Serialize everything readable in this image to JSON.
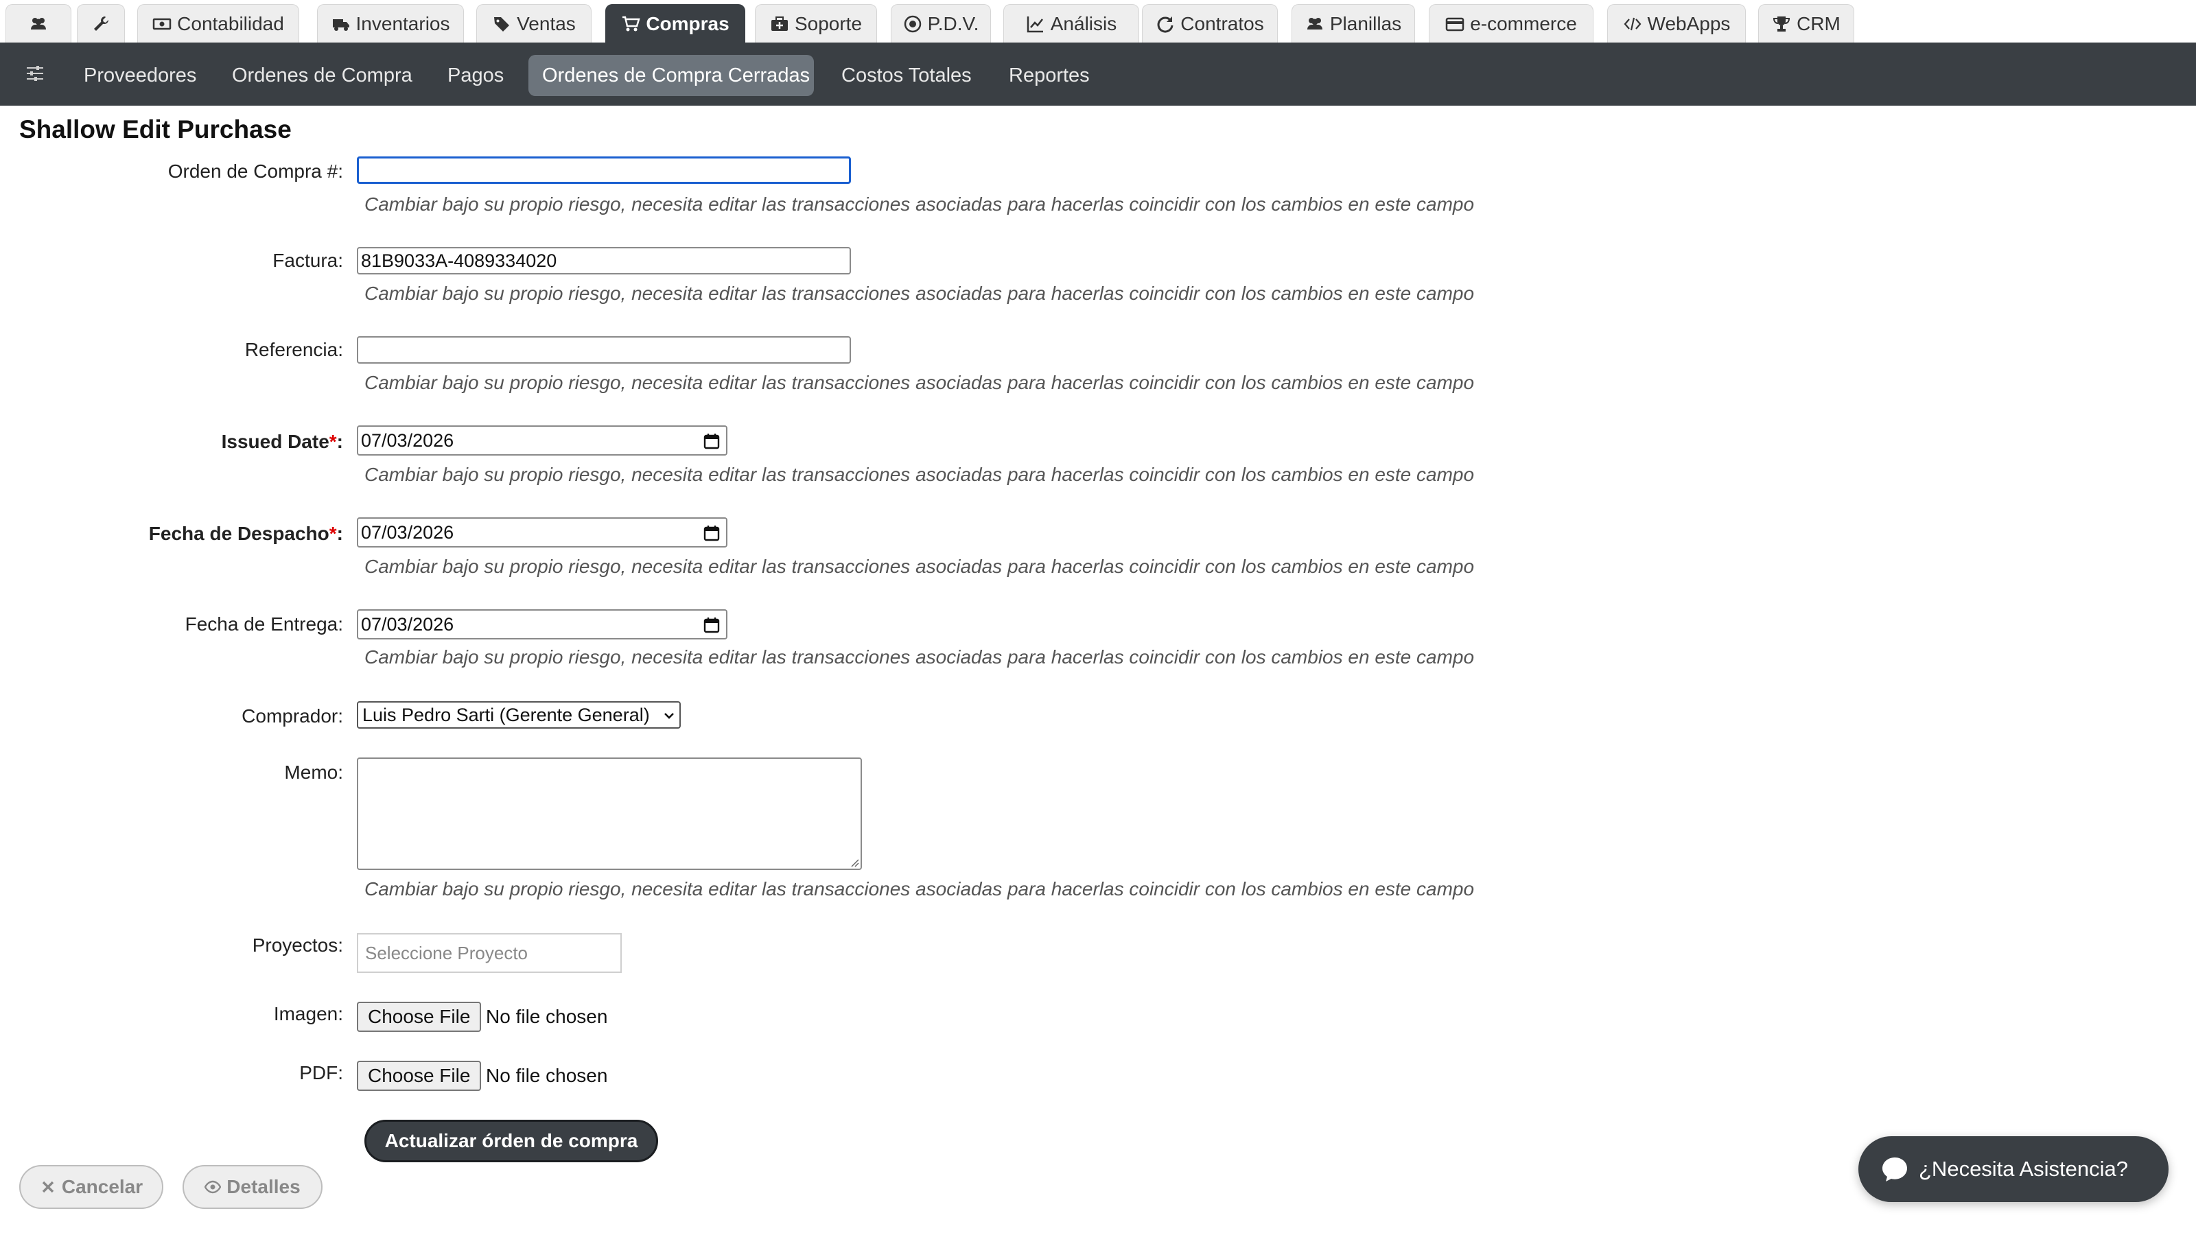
{
  "top_tabs": [
    {
      "label": "",
      "icon": "users-icon"
    },
    {
      "label": "",
      "icon": "wrench-icon"
    },
    {
      "label": "Contabilidad",
      "icon": "money-icon"
    },
    {
      "label": "Inventarios",
      "icon": "truck-icon"
    },
    {
      "label": "Ventas",
      "icon": "tags-icon"
    },
    {
      "label": "Compras",
      "icon": "cart-icon",
      "active": true
    },
    {
      "label": "Soporte",
      "icon": "medkit-icon"
    },
    {
      "label": "P.D.V.",
      "icon": "target-icon"
    },
    {
      "label": "Análisis",
      "icon": "chart-line-icon"
    },
    {
      "label": "Contratos",
      "icon": "refresh-icon"
    },
    {
      "label": "Planillas",
      "icon": "users-icon"
    },
    {
      "label": "e-commerce",
      "icon": "credit-card-icon"
    },
    {
      "label": "WebApps",
      "icon": "code-icon"
    },
    {
      "label": "CRM",
      "icon": "trophy-icon"
    }
  ],
  "sub_nav": {
    "items": [
      {
        "label": "Proveedores"
      },
      {
        "label": "Ordenes de Compra"
      },
      {
        "label": "Pagos"
      },
      {
        "label": "Ordenes de Compra Cerradas",
        "active": true
      },
      {
        "label": "Costos Totales"
      },
      {
        "label": "Reportes"
      }
    ]
  },
  "page_title": "Shallow Edit Purchase",
  "warning_text": "Cambiar bajo su propio riesgo, necesita editar las transacciones asociadas para hacerlas coincidir con los cambios en este campo",
  "fields": {
    "orden": {
      "label": "Orden de Compra #:",
      "value": ""
    },
    "factura": {
      "label": "Factura:",
      "value": "81B9033A-4089334020"
    },
    "referencia": {
      "label": "Referencia:",
      "value": ""
    },
    "issued_date": {
      "label": "Issued Date",
      "value": "07/03/2026"
    },
    "fecha_despacho": {
      "label": "Fecha de Despacho",
      "value": "07/03/2026"
    },
    "fecha_entrega": {
      "label": "Fecha de Entrega:",
      "value": "07/03/2026"
    },
    "comprador": {
      "label": "Comprador:",
      "value": "Luis Pedro Sarti (Gerente General)"
    },
    "memo": {
      "label": "Memo:",
      "value": ""
    },
    "proyectos": {
      "label": "Proyectos:",
      "placeholder": "Seleccione Proyecto"
    },
    "imagen": {
      "label": "Imagen:",
      "button": "Choose File",
      "status": "No file chosen"
    },
    "pdf": {
      "label": "PDF:",
      "button": "Choose File",
      "status": "No file chosen"
    }
  },
  "required_marker": "*",
  "colon": ":",
  "actions": {
    "update": "Actualizar órden de compra",
    "cancel": "Cancelar",
    "details": "Detalles"
  },
  "help_chat": "¿Necesita Asistencia?",
  "colors": {
    "dark_nav": "#3a3f44",
    "active_subnav": "#6c747c",
    "focus_border": "#1a5fd0",
    "required": "#dd0000"
  }
}
